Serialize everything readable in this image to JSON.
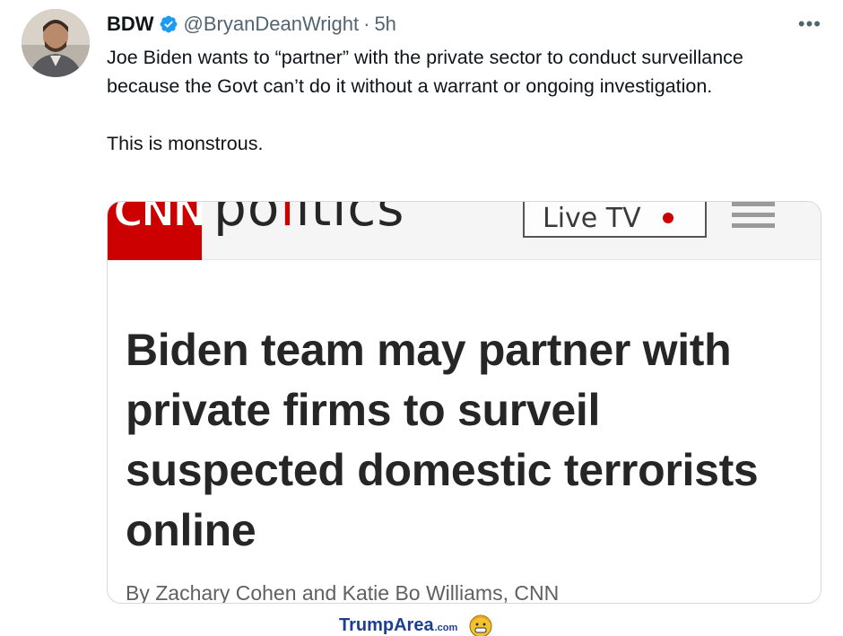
{
  "author": {
    "display_name": "BDW",
    "handle": "@BryanDeanWright",
    "separator": "·",
    "time": "5h",
    "verified": true,
    "more_icon": "more-horizontal-icon"
  },
  "tweet": {
    "paragraphs": [
      "Joe Biden wants to “partner” with the private sector to conduct surveillance because the Govt can’t do it without a warrant or ongoing investigation.",
      "This is monstrous."
    ]
  },
  "card": {
    "logo": "CNN",
    "section_pre": "po",
    "section_i": "l",
    "section_post": "itics",
    "live_tv_label": "Live TV",
    "menu_icon": "hamburger-menu-icon",
    "headline": "Biden team may partner with private firms to surveil suspected domestic terrorists online",
    "byline": "By Zachary Cohen and Katie Bo Williams, CNN"
  },
  "watermark": {
    "text": "TrumpArea",
    "suffix": ".com"
  },
  "colors": {
    "verified_blue": "#1d9bf0",
    "cnn_red": "#cc0000",
    "secondary_text": "#536471",
    "watermark_blue": "#1d3f93"
  }
}
